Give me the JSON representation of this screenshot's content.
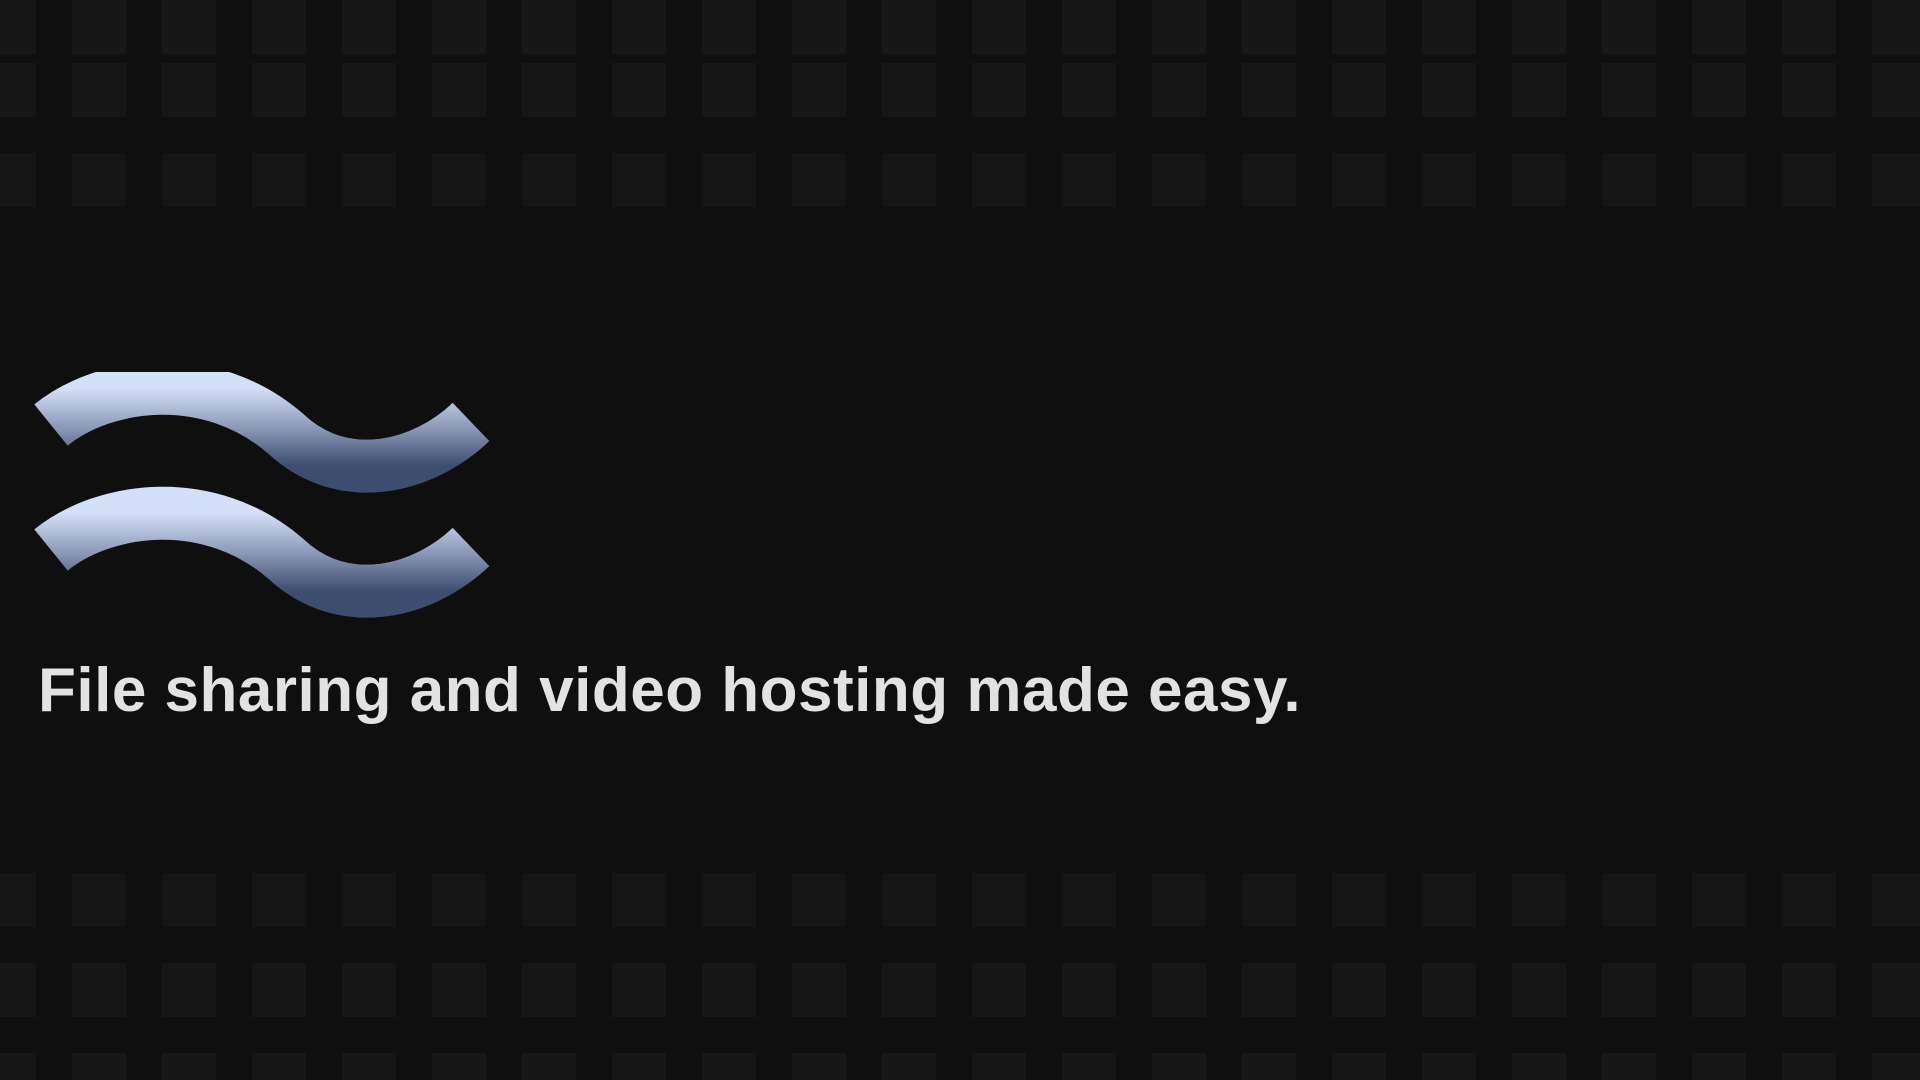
{
  "hero": {
    "logo_icon": "waves-icon",
    "tagline": "File sharing and video hosting made easy."
  },
  "colors": {
    "background": "#0f0f10",
    "tile": "#171717",
    "logo_gradient_top": "#d3e0f8",
    "logo_gradient_bottom": "#3d4d70",
    "tagline": "#e2e2e2"
  }
}
